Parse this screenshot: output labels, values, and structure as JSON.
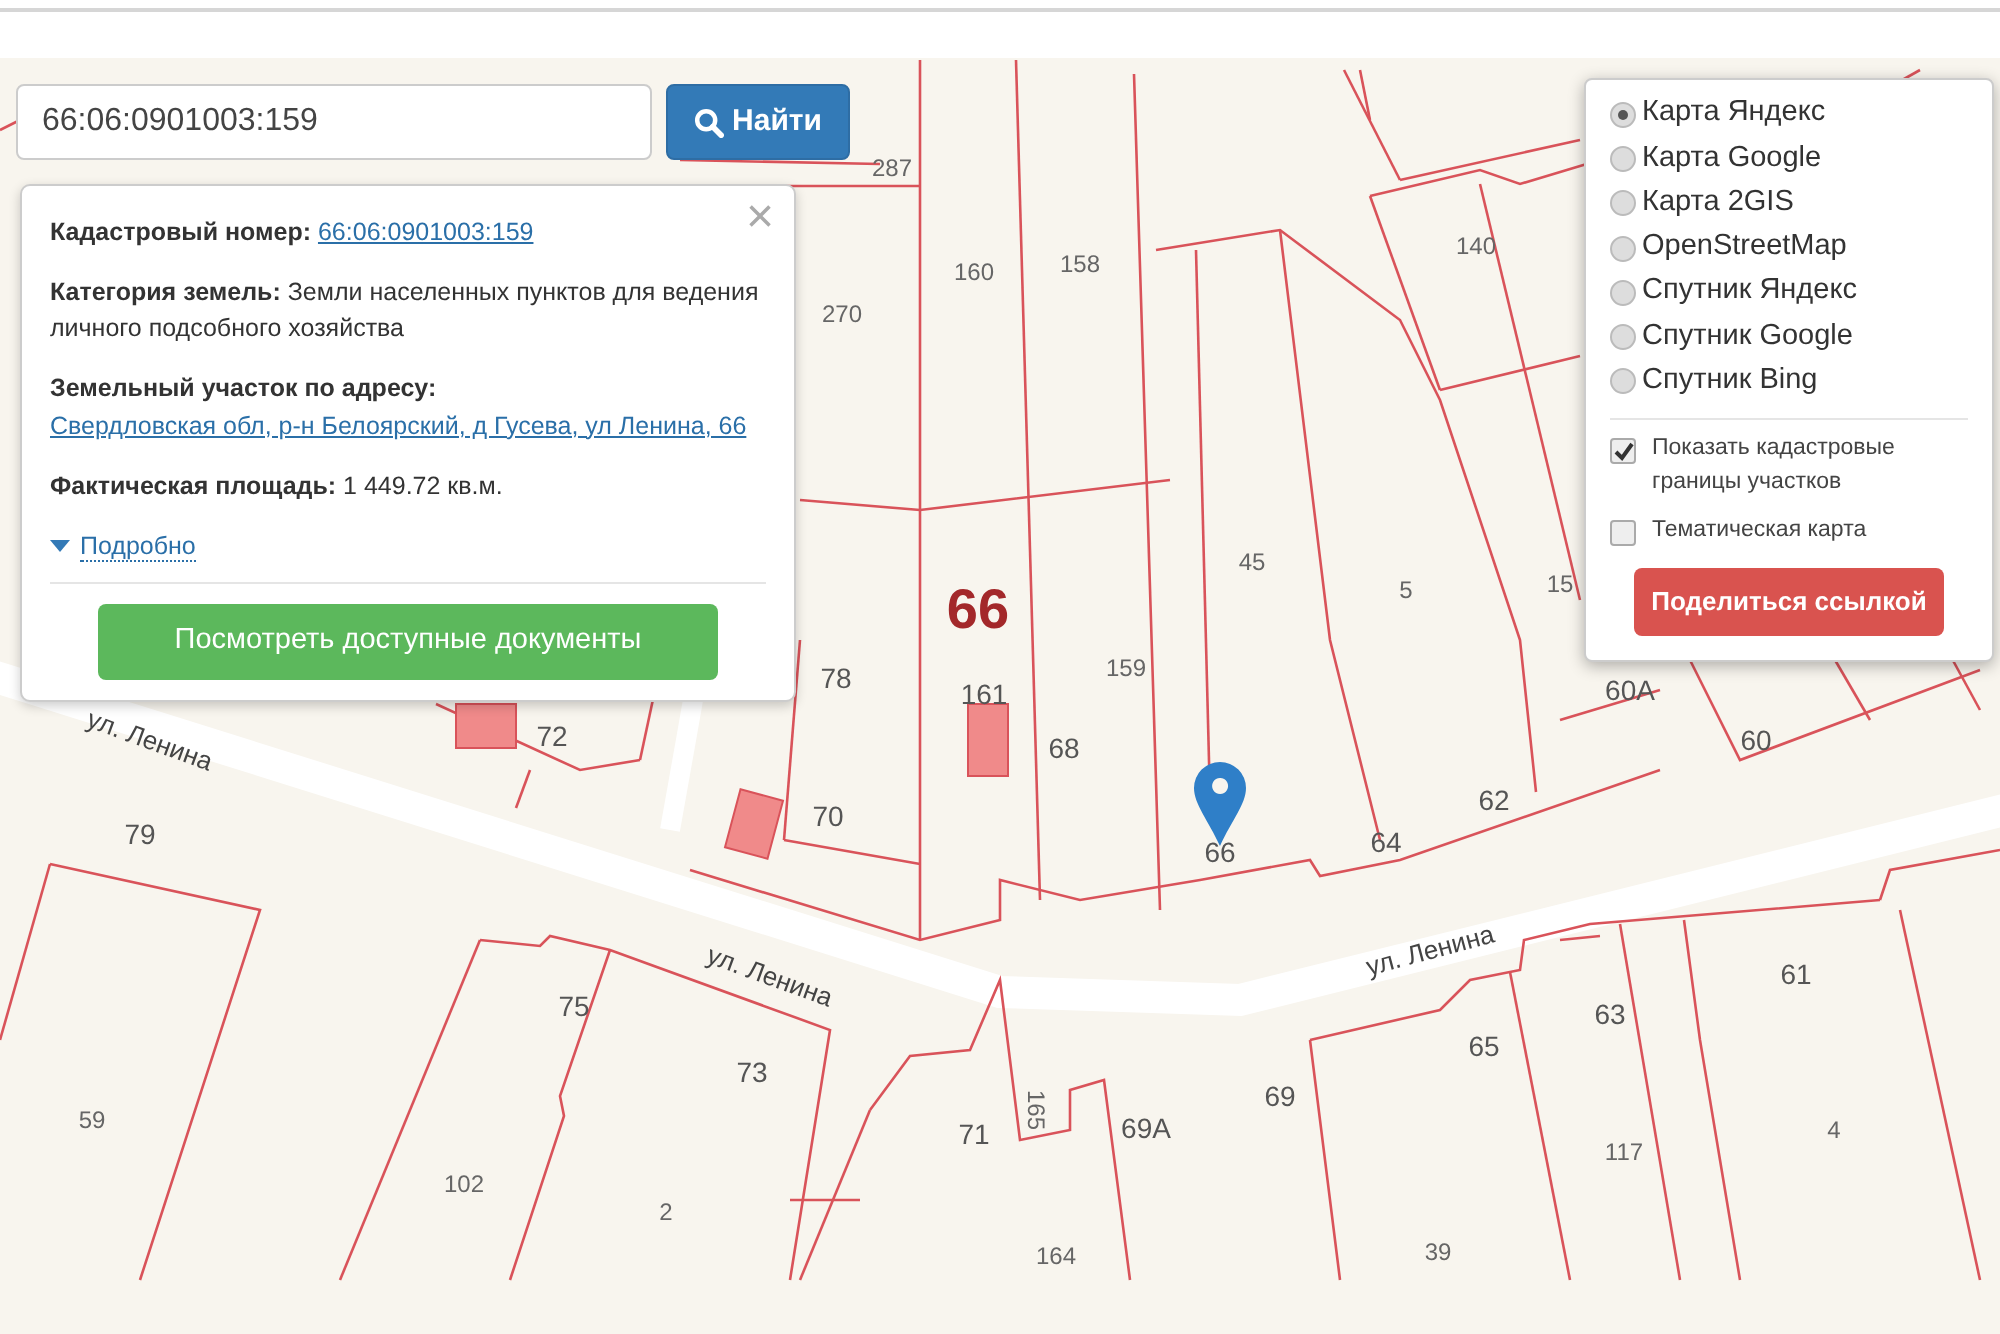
{
  "search": {
    "value": "66:06:0901003:159",
    "button": "Найти"
  },
  "info_popup": {
    "close": "×",
    "rows": [
      {
        "label": "Кадастровый номер:",
        "value": "66:06:0901003:159",
        "kind": "link"
      },
      {
        "label": "Категория земель:",
        "value": "Земли населенных пунктов для ведения личного подсобного хозяйства",
        "kind": "text"
      },
      {
        "label": "Земельный участок по адресу:",
        "value": "Свердловская обл, р-н Белоярский, д Гусева, ул Ленина, 66",
        "kind": "link"
      },
      {
        "label": "Фактическая площадь:",
        "value": "1 449.72 кв.м.",
        "kind": "text"
      }
    ],
    "details_toggle": {
      "label": "Подробно",
      "expanded": false
    },
    "documents_button": "Посмотреть доступные документы"
  },
  "layers": {
    "base_maps": [
      {
        "label": "Карта Яндекс",
        "selected": true
      },
      {
        "label": "Карта Google",
        "selected": false
      },
      {
        "label": "Карта 2GIS",
        "selected": false
      },
      {
        "label": "OpenStreetMap",
        "selected": false
      },
      {
        "label": "Спутник Яндекс",
        "selected": false
      },
      {
        "label": "Спутник Google",
        "selected": false
      },
      {
        "label": "Спутник Bing",
        "selected": false
      }
    ],
    "options": [
      {
        "label": "Показать кадастровые границы участков",
        "checked": true
      },
      {
        "label": "Тематическая карта",
        "checked": false
      }
    ],
    "share_button": "Поделиться ссылкой"
  },
  "map": {
    "labels": [
      {
        "text": "287",
        "kind": "parcel"
      },
      {
        "text": "160",
        "kind": "parcel"
      },
      {
        "text": "158",
        "kind": "parcel"
      },
      {
        "text": "270",
        "kind": "parcel"
      },
      {
        "text": "140",
        "kind": "parcel"
      },
      {
        "text": "45",
        "kind": "parcel"
      },
      {
        "text": "5",
        "kind": "parcel"
      },
      {
        "text": "15",
        "kind": "parcel"
      },
      {
        "text": "66",
        "kind": "block"
      },
      {
        "text": "159",
        "kind": "parcel"
      },
      {
        "text": "161",
        "kind": "house"
      },
      {
        "text": "68",
        "kind": "house"
      },
      {
        "text": "78",
        "kind": "house"
      },
      {
        "text": "72",
        "kind": "house"
      },
      {
        "text": "70",
        "kind": "house"
      },
      {
        "text": "60А",
        "kind": "house"
      },
      {
        "text": "60",
        "kind": "house"
      },
      {
        "text": "62",
        "kind": "house"
      },
      {
        "text": "64",
        "kind": "house"
      },
      {
        "text": "66",
        "kind": "house"
      },
      {
        "text": "79",
        "kind": "house"
      },
      {
        "text": "75",
        "kind": "house"
      },
      {
        "text": "73",
        "kind": "house"
      },
      {
        "text": "59",
        "kind": "parcel"
      },
      {
        "text": "102",
        "kind": "parcel"
      },
      {
        "text": "2",
        "kind": "parcel"
      },
      {
        "text": "71",
        "kind": "house"
      },
      {
        "text": "165",
        "kind": "parcel"
      },
      {
        "text": "69А",
        "kind": "house"
      },
      {
        "text": "69",
        "kind": "house"
      },
      {
        "text": "164",
        "kind": "parcel"
      },
      {
        "text": "65",
        "kind": "house"
      },
      {
        "text": "63",
        "kind": "house"
      },
      {
        "text": "61",
        "kind": "house"
      },
      {
        "text": "117",
        "kind": "parcel"
      },
      {
        "text": "4",
        "kind": "parcel"
      },
      {
        "text": "39",
        "kind": "parcel"
      },
      {
        "text": "ул. Ленина",
        "kind": "street"
      },
      {
        "text": "ул. Ленина",
        "kind": "street"
      },
      {
        "text": "ул. Ленина",
        "kind": "street"
      }
    ]
  }
}
